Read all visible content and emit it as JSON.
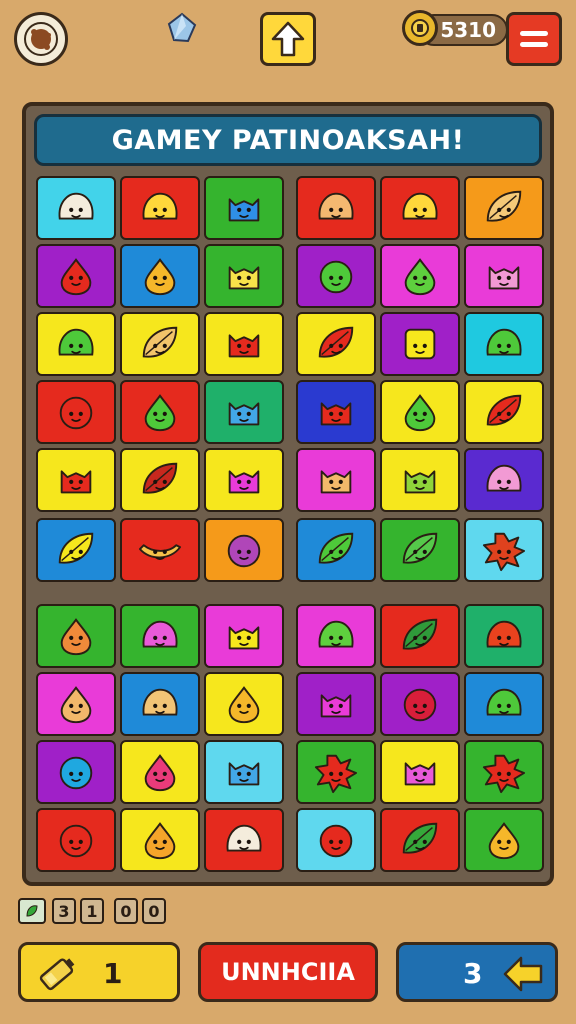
{
  "topbar": {
    "coins": "5310"
  },
  "board": {
    "title": "GAMEY PATINOAKSAH!",
    "tiles": [
      {
        "color": "#42d3ea",
        "face": "#f4ecdc",
        "shape": "blob"
      },
      {
        "color": "#e52a1e",
        "face": "#ffd83b",
        "shape": "blob"
      },
      {
        "color": "#35b42e",
        "face": "#2f8fe6",
        "shape": "cat"
      },
      {
        "color": "#e52a1e",
        "face": "#f4b870",
        "shape": "blob"
      },
      {
        "color": "#e52a1e",
        "face": "#ffd83b",
        "shape": "blob"
      },
      {
        "color": "#f59a1a",
        "face": "#f4c978",
        "shape": "leaf"
      },
      {
        "color": "#a020c8",
        "face": "#e52a1e",
        "shape": "drop"
      },
      {
        "color": "#1f8ad8",
        "face": "#f5b72a",
        "shape": "drop"
      },
      {
        "color": "#35b42e",
        "face": "#f7e24a",
        "shape": "cat"
      },
      {
        "color": "#a020c8",
        "face": "#4ec93a",
        "shape": "round"
      },
      {
        "color": "#e93bd8",
        "face": "#5ecf3e",
        "shape": "drop"
      },
      {
        "color": "#e93bd8",
        "face": "#f29ad4",
        "shape": "cat"
      },
      {
        "color": "#f6e71d",
        "face": "#4ec93a",
        "shape": "blob"
      },
      {
        "color": "#f6e71d",
        "face": "#f2c46a",
        "shape": "leaf"
      },
      {
        "color": "#f6e71d",
        "face": "#e52a1e",
        "shape": "cat"
      },
      {
        "color": "#f6e71d",
        "face": "#e52a1e",
        "shape": "leaf"
      },
      {
        "color": "#a020c8",
        "face": "#f6e71d",
        "shape": "square"
      },
      {
        "color": "#1fc9e0",
        "face": "#4ec93a",
        "shape": "blob"
      },
      {
        "color": "#e52a1e",
        "face": "#e52a1e",
        "shape": "round"
      },
      {
        "color": "#e52a1e",
        "face": "#4ec93a",
        "shape": "drop"
      },
      {
        "color": "#1fb06a",
        "face": "#42a7e6",
        "shape": "cat"
      },
      {
        "color": "#2a3ad0",
        "face": "#e52a1e",
        "shape": "cat"
      },
      {
        "color": "#f6e71d",
        "face": "#4ec93a",
        "shape": "drop"
      },
      {
        "color": "#f6e71d",
        "face": "#e52a1e",
        "shape": "leaf"
      },
      {
        "color": "#f6e71d",
        "face": "#e52a1e",
        "shape": "cat"
      },
      {
        "color": "#f6e71d",
        "face": "#c8281e",
        "shape": "leaf"
      },
      {
        "color": "#f6e71d",
        "face": "#e93bd8",
        "shape": "cat"
      },
      {
        "color": "#e93bd8",
        "face": "#f2b86a",
        "shape": "cat"
      },
      {
        "color": "#f6e71d",
        "face": "#8fd43a",
        "shape": "cat"
      },
      {
        "color": "#5a2ad0",
        "face": "#f29ad4",
        "shape": "blob"
      },
      {
        "color": "#1f8ad8",
        "face": "#f6e71d",
        "shape": "leaf"
      },
      {
        "color": "#e52a1e",
        "face": "#f5c24a",
        "shape": "banana"
      },
      {
        "color": "#f59a1a",
        "face": "#b046b8",
        "shape": "round"
      },
      {
        "color": "#1f8ad8",
        "face": "#4ec93a",
        "shape": "leaf"
      },
      {
        "color": "#35b42e",
        "face": "#55c94a",
        "shape": "leaf"
      },
      {
        "color": "#5fd8ee",
        "face": "#e0421e",
        "shape": "splat"
      },
      {
        "color": "#35b42e",
        "face": "#f08a3a",
        "shape": "drop"
      },
      {
        "color": "#35b42e",
        "face": "#e95ad8",
        "shape": "blob"
      },
      {
        "color": "#e93bd8",
        "face": "#f6e71d",
        "shape": "cat"
      },
      {
        "color": "#e93bd8",
        "face": "#5ecf3e",
        "shape": "blob"
      },
      {
        "color": "#e52a1e",
        "face": "#2f9a3a",
        "shape": "leaf"
      },
      {
        "color": "#1fb06a",
        "face": "#e9421e",
        "shape": "blob"
      },
      {
        "color": "#e93bd8",
        "face": "#f2b86a",
        "shape": "drop"
      },
      {
        "color": "#1f8ad8",
        "face": "#f2c476",
        "shape": "blob"
      },
      {
        "color": "#f6e71d",
        "face": "#f5b72a",
        "shape": "drop"
      },
      {
        "color": "#a020c8",
        "face": "#e93bd8",
        "shape": "cat"
      },
      {
        "color": "#a020c8",
        "face": "#d81e3a",
        "shape": "round"
      },
      {
        "color": "#1f8ad8",
        "face": "#4ec93a",
        "shape": "blob"
      },
      {
        "color": "#a020c8",
        "face": "#1fa8e0",
        "shape": "round"
      },
      {
        "color": "#f6e71d",
        "face": "#e93b7a",
        "shape": "drop"
      },
      {
        "color": "#5fd8ee",
        "face": "#42a7e6",
        "shape": "cat"
      },
      {
        "color": "#35b42e",
        "face": "#e52a1e",
        "shape": "splat"
      },
      {
        "color": "#f6e71d",
        "face": "#e95ad8",
        "shape": "cat"
      },
      {
        "color": "#35b42e",
        "face": "#e52a1e",
        "shape": "splat"
      },
      {
        "color": "#e52a1e",
        "face": "#e52a1e",
        "shape": "round"
      },
      {
        "color": "#f6e71d",
        "face": "#f5a52a",
        "shape": "drop"
      },
      {
        "color": "#e52a1e",
        "face": "#f4ecdc",
        "shape": "blob"
      },
      {
        "color": "#5fd8ee",
        "face": "#e52a1e",
        "shape": "round"
      },
      {
        "color": "#e52a1e",
        "face": "#35a83a",
        "shape": "leaf"
      },
      {
        "color": "#35b42e",
        "face": "#f5b72a",
        "shape": "drop"
      }
    ]
  },
  "stats": {
    "items": [
      "3",
      "1",
      "0",
      "0"
    ]
  },
  "bottom": {
    "left_value": "1",
    "center_label": "UNNHCIIA",
    "right_value": "3"
  }
}
